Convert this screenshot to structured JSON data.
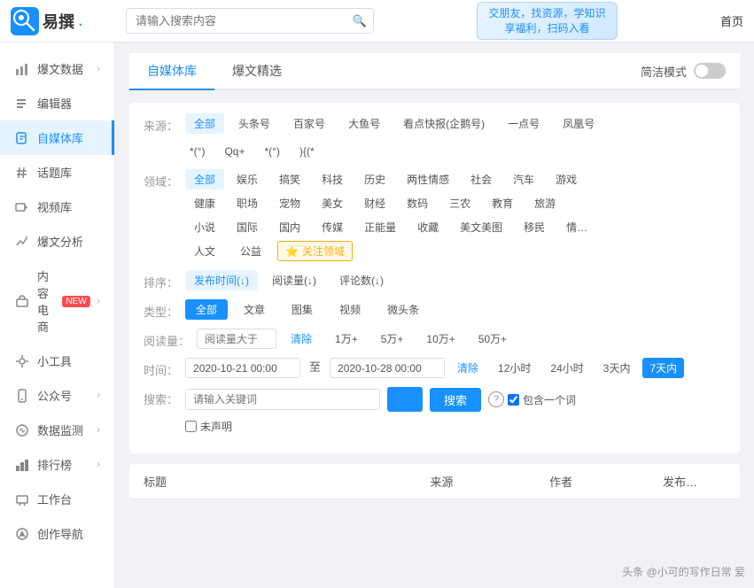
{
  "topbar": {
    "logo_text": "易撰",
    "logo_char": "撰",
    "search_placeholder": "请输入搜索内容",
    "banner_line1": "交朋友，找资源，学知识",
    "banner_line2": "享福利，扫码入看",
    "home_label": "首页"
  },
  "sidebar": {
    "items": [
      {
        "id": "baobao",
        "label": "爆文数据",
        "icon": "📊",
        "arrow": true,
        "active": false
      },
      {
        "id": "bianji",
        "label": "编辑器",
        "icon": "✏️",
        "arrow": false,
        "active": false
      },
      {
        "id": "zimeiti",
        "label": "自媒体库",
        "icon": "🎵",
        "arrow": false,
        "active": true
      },
      {
        "id": "huati",
        "label": "话题库",
        "icon": "#",
        "arrow": false,
        "active": false
      },
      {
        "id": "shipin",
        "label": "视频库",
        "icon": "▶",
        "arrow": false,
        "active": false
      },
      {
        "id": "fenxi",
        "label": "爆文分析",
        "icon": "📈",
        "arrow": false,
        "active": false
      },
      {
        "id": "dianshang",
        "label": "内容电商",
        "icon": "🛒",
        "arrow": true,
        "active": false,
        "new": true
      },
      {
        "id": "gongju",
        "label": "小工具",
        "icon": "🔧",
        "arrow": false,
        "active": false
      },
      {
        "id": "gongzhong",
        "label": "公众号",
        "icon": "📱",
        "arrow": true,
        "active": false
      },
      {
        "id": "jiankong",
        "label": "数据监测",
        "icon": "📡",
        "arrow": true,
        "active": false
      },
      {
        "id": "paihang",
        "label": "排行榜",
        "icon": "🏆",
        "arrow": true,
        "active": false
      },
      {
        "id": "gongzuotai",
        "label": "工作台",
        "icon": "💼",
        "arrow": false,
        "active": false
      },
      {
        "id": "chuangzuo",
        "label": "创作导航",
        "icon": "🧭",
        "arrow": false,
        "active": false
      }
    ]
  },
  "tabs": {
    "items": [
      {
        "id": "zimeiti",
        "label": "自媒体库",
        "active": true
      },
      {
        "id": "baobao",
        "label": "爆文精选",
        "active": false
      }
    ],
    "mode_label": "简洁模式"
  },
  "filters": {
    "source_label": "来源：",
    "sources": [
      {
        "label": "全部",
        "active": true
      },
      {
        "label": "头条号",
        "active": false
      },
      {
        "label": "百家号",
        "active": false
      },
      {
        "label": "大鱼号",
        "active": false
      },
      {
        "label": "看点快报(企鹅号)",
        "active": false
      },
      {
        "label": "一点号",
        "active": false
      },
      {
        "label": "凤凰号",
        "active": false
      }
    ],
    "source_special": [
      {
        "label": "*(°)",
        "active": false
      },
      {
        "label": "Qq+",
        "active": false
      },
      {
        "label": "*(°)",
        "active": false
      },
      {
        "label": "){(*",
        "active": false
      }
    ],
    "domain_label": "领域：",
    "domains_row1": [
      {
        "label": "全部",
        "active": true
      },
      {
        "label": "娱乐",
        "active": false
      },
      {
        "label": "搞笑",
        "active": false
      },
      {
        "label": "科技",
        "active": false
      },
      {
        "label": "历史",
        "active": false
      },
      {
        "label": "两性情感",
        "active": false
      },
      {
        "label": "社会",
        "active": false
      },
      {
        "label": "汽车",
        "active": false
      },
      {
        "label": "游戏",
        "active": false
      }
    ],
    "domains_row2": [
      {
        "label": "健康",
        "active": false
      },
      {
        "label": "职场",
        "active": false
      },
      {
        "label": "宠物",
        "active": false
      },
      {
        "label": "美女",
        "active": false
      },
      {
        "label": "财经",
        "active": false
      },
      {
        "label": "数码",
        "active": false
      },
      {
        "label": "三农",
        "active": false
      },
      {
        "label": "教育",
        "active": false
      },
      {
        "label": "旅游",
        "active": false
      }
    ],
    "domains_row3": [
      {
        "label": "小说",
        "active": false
      },
      {
        "label": "国际",
        "active": false
      },
      {
        "label": "国内",
        "active": false
      },
      {
        "label": "传媒",
        "active": false
      },
      {
        "label": "正能量",
        "active": false
      },
      {
        "label": "收藏",
        "active": false
      },
      {
        "label": "美文美图",
        "active": false
      },
      {
        "label": "移民",
        "active": false
      },
      {
        "label": "情…",
        "active": false
      }
    ],
    "domains_row4": [
      {
        "label": "人文",
        "active": false
      },
      {
        "label": "公益",
        "active": false
      }
    ],
    "focus_field_label": "⭐ 关注领域",
    "sort_label": "排序：",
    "sorts": [
      {
        "label": "发布时间(↓)",
        "active": true
      },
      {
        "label": "阅读量(↓)",
        "active": false
      },
      {
        "label": "评论数(↓)",
        "active": false
      }
    ],
    "type_label": "类型：",
    "types": [
      {
        "label": "全部",
        "active": true
      },
      {
        "label": "文章",
        "active": false
      },
      {
        "label": "图集",
        "active": false
      },
      {
        "label": "视频",
        "active": false
      },
      {
        "label": "微头条",
        "active": false
      }
    ],
    "read_label": "阅读量：",
    "read_placeholder": "阅读量大于",
    "read_clear": "清除",
    "read_options": [
      "1万+",
      "5万+",
      "10万+",
      "50万+"
    ],
    "time_label": "时间：",
    "time_start": "2020-10-21 00:00",
    "time_to": "至",
    "time_end": "2020-10-28 00:00",
    "time_clear": "清除",
    "time_options": [
      {
        "label": "12小时",
        "active": false
      },
      {
        "label": "24小时",
        "active": false
      },
      {
        "label": "3天内",
        "active": false
      },
      {
        "label": "7天内",
        "active": true
      }
    ],
    "search_label": "搜索：",
    "search_placeholder": "请输入关键词",
    "search_btn": "搜索",
    "help_icon": "?",
    "include_word": "包含一个词",
    "no_declare": "未声明"
  },
  "table": {
    "columns": [
      "标题",
      "来源",
      "作者",
      "发布…"
    ]
  },
  "watermark": "头条 @小可的写作日常 爱"
}
